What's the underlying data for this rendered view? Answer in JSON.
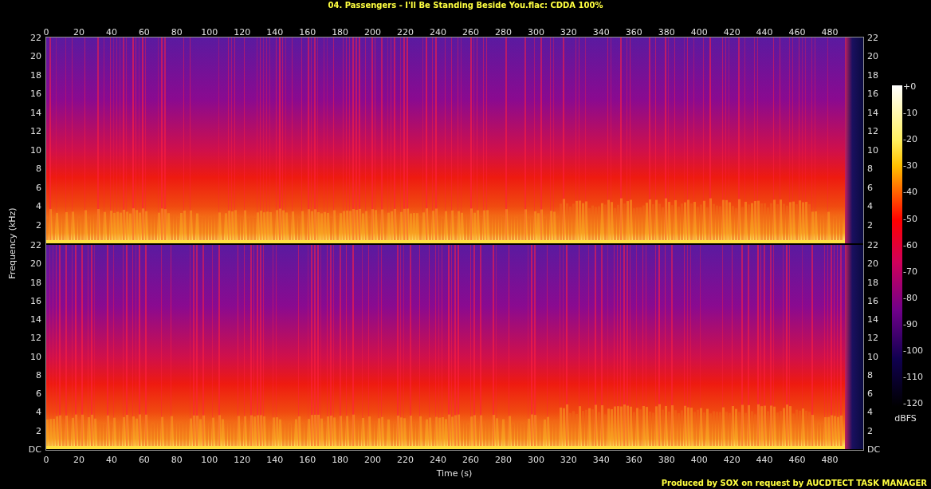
{
  "title": "04. Passengers - I'll Be Standing Beside You.flac: CDDA 100%",
  "top_time_ticks": [
    "0",
    "20",
    "40",
    "60",
    "80",
    "100",
    "120",
    "140",
    "160",
    "180",
    "200",
    "220",
    "240",
    "260",
    "280",
    "300",
    "320",
    "340",
    "360",
    "380",
    "400",
    "420",
    "440",
    "460",
    "480"
  ],
  "bottom_time_ticks": [
    "0",
    "20",
    "40",
    "60",
    "80",
    "100",
    "120",
    "140",
    "160",
    "180",
    "200",
    "220",
    "240",
    "260",
    "280",
    "300",
    "320",
    "340",
    "360",
    "380",
    "400",
    "420",
    "440",
    "460",
    "480"
  ],
  "frequency_label": "Frequency (kHz)",
  "channels": [
    {
      "left_ticks": [
        "22",
        "20",
        "18",
        "16",
        "14",
        "12",
        "10",
        "8",
        "6",
        "4",
        "2"
      ],
      "right_ticks": [
        "22",
        "20",
        "18",
        "16",
        "14",
        "12",
        "10",
        "8",
        "6",
        "4",
        "2"
      ]
    },
    {
      "left_ticks": [
        "22",
        "20",
        "18",
        "16",
        "14",
        "12",
        "10",
        "8",
        "6",
        "4",
        "2",
        "DC"
      ],
      "right_ticks": [
        "22",
        "20",
        "18",
        "16",
        "14",
        "12",
        "10",
        "8",
        "6",
        "4",
        "2",
        "DC"
      ]
    }
  ],
  "time_label": "Time (s)",
  "color_scale": {
    "ticks": [
      "+0",
      "-10",
      "-20",
      "-30",
      "-40",
      "-50",
      "-60",
      "-70",
      "-80",
      "-90",
      "-100",
      "-110",
      "-120"
    ],
    "unit": "dBFS"
  },
  "footer": "Produced by SOX on request by AUCDTECT TASK MANAGER"
}
